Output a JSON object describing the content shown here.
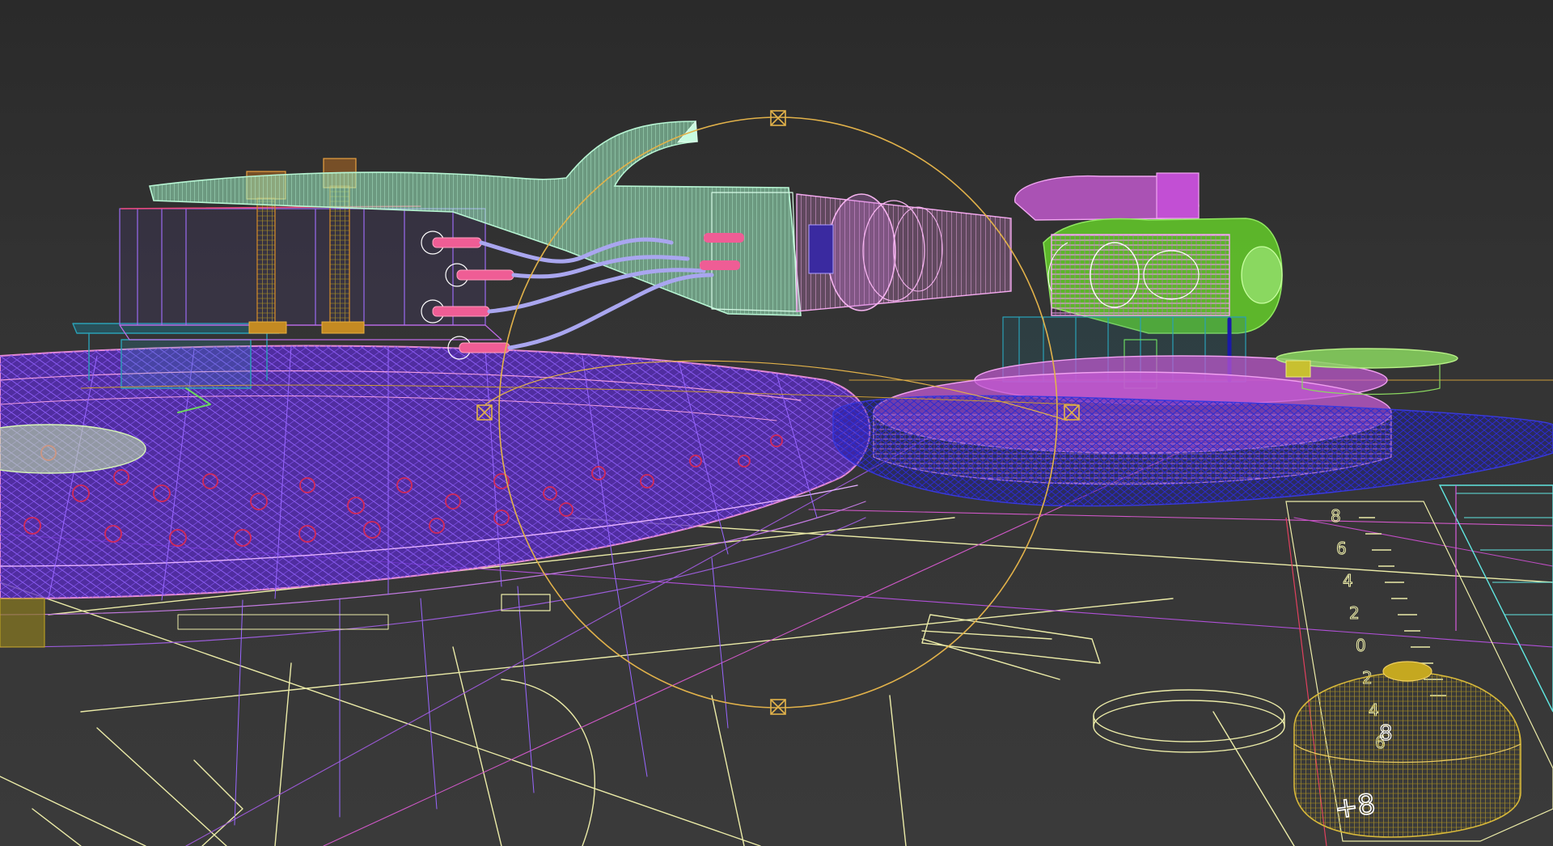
{
  "viewport": {
    "view_type": "wireframe-3d-viewport",
    "subject": "turntable tonearm assembly",
    "shading": "wireframe",
    "background_color": "#333333"
  },
  "colors": {
    "platter_purple": "#5a2bc4",
    "platter_edge_pink": "#e58ad8",
    "headshell_mint": "#9ff0c2",
    "armtube_pink": "#ee90e6",
    "pivot_magenta": "#d35ee0",
    "pivot_green": "#62c42a",
    "base_blue": "#1a1aa8",
    "plinth_yellow": "#ececa8",
    "gizmo_orange": "#e2b24a",
    "pitch_slider_olive": "#c5a820",
    "wires_lavender": "#a9a6ef",
    "pins_pink": "#ef5d95",
    "screws_orange": "#d88d2a",
    "bracket_cyan": "#2aa0b6"
  },
  "gizmo": {
    "type": "rotate-gizmo",
    "handle_count": 4
  },
  "pitch_scale": {
    "labels": [
      "8",
      "6",
      "4",
      "2",
      "0",
      "2",
      "4",
      "6",
      "8"
    ],
    "slider_label": "+8"
  }
}
